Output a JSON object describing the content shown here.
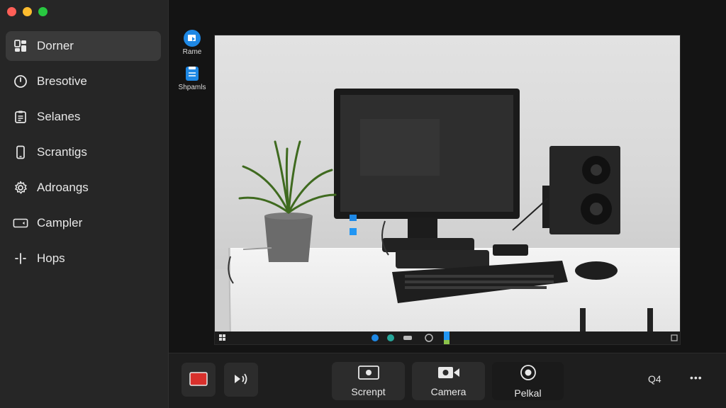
{
  "window": {
    "traffic_lights": {
      "close": "#ff5f57",
      "minimize": "#febc2e",
      "maximize": "#28c840"
    }
  },
  "sidebar": {
    "items": [
      {
        "label": "Dorner",
        "icon": "dashboard-icon",
        "active": true
      },
      {
        "label": "Bresotive",
        "icon": "clock-icon"
      },
      {
        "label": "Selanes",
        "icon": "clipboard-icon"
      },
      {
        "label": "Scrantigs",
        "icon": "phone-icon"
      },
      {
        "label": "Adroangs",
        "icon": "gear-icon"
      },
      {
        "label": "Campler",
        "icon": "screen-icon"
      },
      {
        "label": "Hops",
        "icon": "help-icon"
      }
    ]
  },
  "desktop_icons": [
    {
      "label": "Rame",
      "icon": "folder-icon"
    },
    {
      "label": "Shpamls",
      "icon": "document-icon"
    }
  ],
  "viewport": {
    "scene": "desk-with-monitor-plant-speaker-keyboard-mouse"
  },
  "controls": {
    "record_label": "",
    "audio_label": "",
    "screen_label": "Screnpt",
    "camera_label": "Camera",
    "pelkal_label": "Pelkal",
    "count_label": "Q4",
    "more_label": "•••"
  },
  "colors": {
    "sidebar_bg": "#262626",
    "main_bg": "#141414",
    "accent_blue": "#1e88e5",
    "record_red": "#d9302c"
  }
}
